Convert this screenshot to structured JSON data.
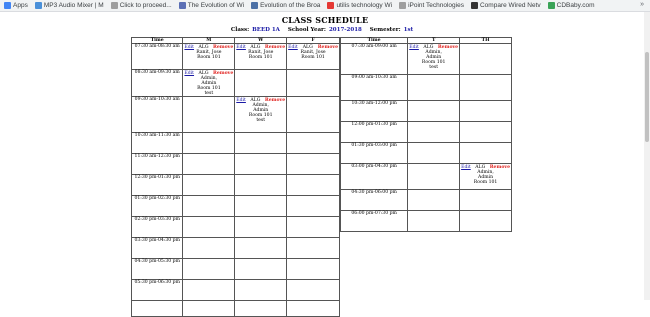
{
  "bookmarks": [
    {
      "label": "Apps",
      "color": "#4285f4"
    },
    {
      "label": "MP3 Audio Mixer | M",
      "color": "#4a90d9"
    },
    {
      "label": "Click to proceed...",
      "color": "#9e9e9e"
    },
    {
      "label": "The Evolution of Wi",
      "color": "#5b6fb5"
    },
    {
      "label": "Evolution of the Broa",
      "color": "#4a6fa5"
    },
    {
      "label": "utilis technology Wi",
      "color": "#e53935"
    },
    {
      "label": "iPoint Technologies",
      "color": "#9e9e9e"
    },
    {
      "label": "Compare Wired Netv",
      "color": "#333333"
    },
    {
      "label": "CDBaby.com",
      "color": "#3aa357"
    }
  ],
  "bookmarks_more": "»",
  "title": "CLASS SCHEDULE",
  "info": {
    "class_label": "Class:",
    "class_value": "BEED 1A",
    "year_label": "School Year:",
    "year_value": "2017-2018",
    "sem_label": "Semester:",
    "sem_value": "1st"
  },
  "left": {
    "headers": [
      "Time",
      "M",
      "W",
      "F"
    ],
    "times": [
      "07:30 am-08:30 am",
      "08:30 am-09:30 am",
      "09:30 am-10:30 am",
      "10:30 am-11:30 am",
      "11:30 am-12:30 pm",
      "12:30 pm-01:30 pm",
      "01:30 pm-02:30 pm",
      "02:30 pm-03:30 pm",
      "03:30 pm-04:30 pm",
      "04:30 pm-05:30 pm",
      "05:30 pm-06:30 pm",
      ""
    ]
  },
  "right": {
    "headers": [
      "Time",
      "T",
      "TH"
    ],
    "times": [
      "07:30 am-09:00 am",
      "09:00 am-10:30 am",
      "10:30 am-12:00 pm",
      "12:00 pm-01:30 pm",
      "01:30 pm-03:00 pm",
      "03:00 pm-04:30 pm",
      "04:30 pm-06:00 pm",
      "06:00 pm-07:30 pm"
    ]
  },
  "classes": {
    "l0_1": {
      "edit": "Edit",
      "code": "ALG",
      "remove": "Remove",
      "lines": [
        "Ranit, Jose",
        "Room 101"
      ]
    },
    "l0_2": {
      "edit": "Edit",
      "code": "ALG",
      "remove": "Remove",
      "lines": [
        "Ranit, Jose",
        "Room 101"
      ]
    },
    "l0_3": {
      "edit": "Edit",
      "code": "ALG",
      "remove": "Remove",
      "lines": [
        "Ranit, Jose",
        "Room 101"
      ]
    },
    "l1_1": {
      "edit": "Edit",
      "code": "ALG",
      "remove": "Remove",
      "lines": [
        "Admin,",
        "Admin",
        "Room 101",
        "test"
      ]
    },
    "l2_2": {
      "edit": "Edit",
      "code": "ALG",
      "remove": "Remove",
      "lines": [
        "Admin,",
        "Admin",
        "Room 101",
        "test"
      ]
    },
    "r0_1": {
      "edit": "Edit",
      "code": "ALG",
      "remove": "Remove",
      "lines": [
        "Admin,",
        "Admin",
        "Room 101",
        "test"
      ]
    },
    "r5_2": {
      "edit": "Edit",
      "code": "ALG",
      "remove": "Remove",
      "lines": [
        "Admin,",
        "Admin",
        "Room 101"
      ]
    }
  }
}
